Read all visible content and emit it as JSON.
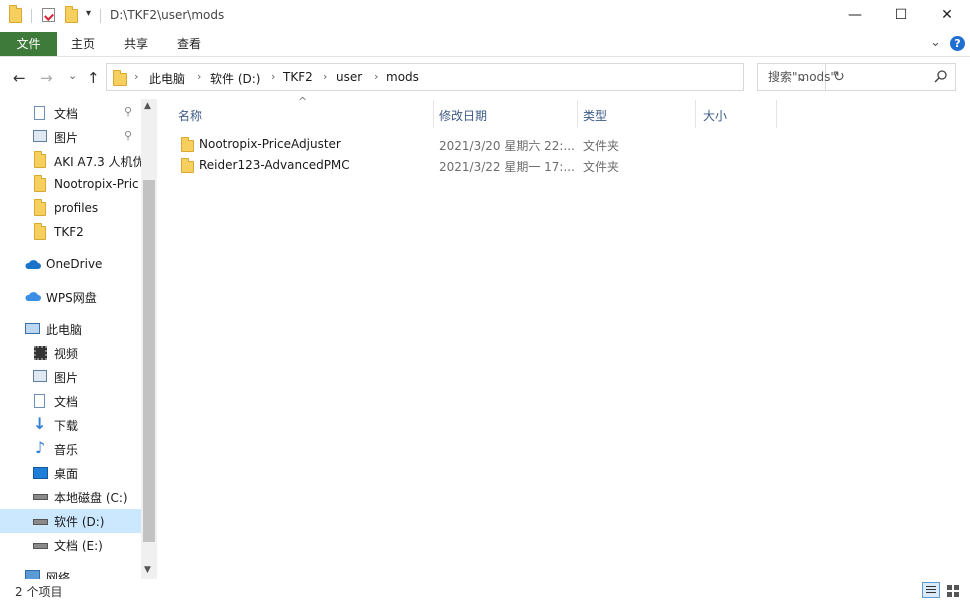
{
  "window": {
    "title": "D:\\TKF2\\user\\mods",
    "minimize": "—",
    "maximize": "☐",
    "close": "✕"
  },
  "ribbon": {
    "tabs": [
      "文件",
      "主页",
      "共享",
      "查看"
    ],
    "collapse": "⌄",
    "help": "?"
  },
  "nav": {
    "back": "←",
    "forward": "→",
    "recent": "⌄",
    "up": "↑",
    "breadcrumb": [
      "此电脑",
      "软件 (D:)",
      "TKF2",
      "user",
      "mods"
    ],
    "dropdown": "⌄",
    "refresh": "↻"
  },
  "search": {
    "placeholder": "搜索\"mods\""
  },
  "sidebar": {
    "items": [
      {
        "label": "文档",
        "icon": "document-icon",
        "pinned": true
      },
      {
        "label": "图片",
        "icon": "picture-icon",
        "pinned": true
      },
      {
        "label": "AKI A7.3 人机优",
        "icon": "folder-icon"
      },
      {
        "label": "Nootropix-Pric",
        "icon": "folder-icon"
      },
      {
        "label": "profiles",
        "icon": "folder-icon"
      },
      {
        "label": "TKF2",
        "icon": "folder-icon"
      },
      {
        "label": "OneDrive",
        "icon": "cloud-icon"
      },
      {
        "label": "WPS网盘",
        "icon": "cloud-icon"
      },
      {
        "label": "此电脑",
        "icon": "computer-icon"
      },
      {
        "label": "视频",
        "icon": "video-icon"
      },
      {
        "label": "图片",
        "icon": "picture-icon"
      },
      {
        "label": "文档",
        "icon": "document-icon"
      },
      {
        "label": "下载",
        "icon": "download-icon"
      },
      {
        "label": "音乐",
        "icon": "music-icon"
      },
      {
        "label": "桌面",
        "icon": "desktop-icon"
      },
      {
        "label": "本地磁盘 (C:)",
        "icon": "drive-icon"
      },
      {
        "label": "软件 (D:)",
        "icon": "drive-icon",
        "selected": true
      },
      {
        "label": "文档 (E:)",
        "icon": "drive-icon"
      },
      {
        "label": "网络",
        "icon": "network-icon"
      }
    ]
  },
  "columns": [
    "名称",
    "修改日期",
    "类型",
    "大小"
  ],
  "files": [
    {
      "name": "Nootropix-PriceAdjuster",
      "date": "2021/3/20 星期六 22:...",
      "type": "文件夹",
      "size": ""
    },
    {
      "name": "Reider123-AdvancedPMC",
      "date": "2021/3/22 星期一 17:...",
      "type": "文件夹",
      "size": ""
    }
  ],
  "status": {
    "text": "2 个项目"
  },
  "colors": {
    "file_tab": "#3e7b3a",
    "selected": "#cce8ff",
    "folder": "#f7cf5e",
    "header_text": "#3c5a85"
  }
}
